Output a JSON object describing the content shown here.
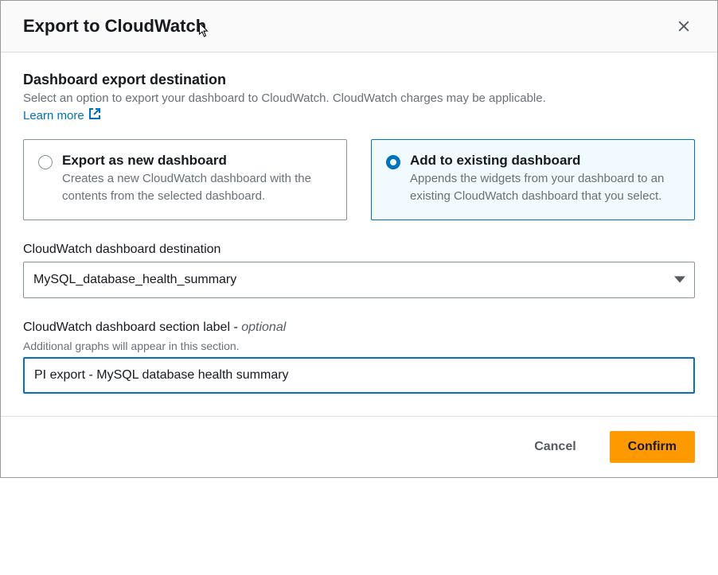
{
  "header": {
    "title": "Export to CloudWatch"
  },
  "destination": {
    "title": "Dashboard export destination",
    "desc": "Select an option to export your dashboard to CloudWatch. CloudWatch charges may be applicable.",
    "learn_more": "Learn more"
  },
  "options": {
    "new": {
      "title": "Export as new dashboard",
      "desc": "Creates a new CloudWatch dashboard with the contents from the selected dashboard."
    },
    "existing": {
      "title": "Add to existing dashboard",
      "desc": "Appends the widgets from your dashboard to an existing CloudWatch dashboard that you select."
    },
    "selected": "existing"
  },
  "dashboard_select": {
    "label": "CloudWatch dashboard destination",
    "value": "MySQL_database_health_summary"
  },
  "section_label": {
    "label_prefix": "CloudWatch dashboard section label - ",
    "label_suffix": "optional",
    "help": "Additional graphs will appear in this section.",
    "value": "PI export - MySQL database health summary"
  },
  "footer": {
    "cancel": "Cancel",
    "confirm": "Confirm"
  }
}
